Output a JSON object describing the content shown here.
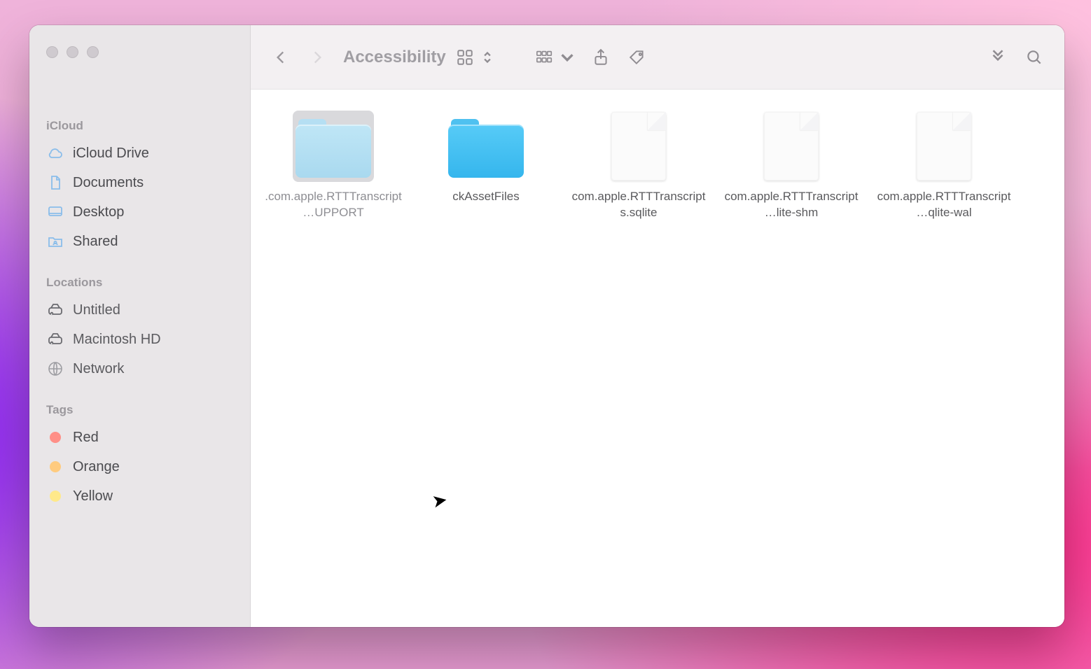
{
  "window": {
    "title": "Accessibility"
  },
  "sidebar": {
    "sections": [
      {
        "header": "iCloud",
        "items": [
          {
            "name": "sidebar-item-icloud-drive",
            "label": "iCloud Drive",
            "icon": "cloud",
            "interactable": true
          },
          {
            "name": "sidebar-item-documents",
            "label": "Documents",
            "icon": "doc",
            "interactable": true
          },
          {
            "name": "sidebar-item-desktop",
            "label": "Desktop",
            "icon": "desktop",
            "interactable": true
          },
          {
            "name": "sidebar-item-shared",
            "label": "Shared",
            "icon": "shared",
            "interactable": true
          }
        ]
      },
      {
        "header": "Locations",
        "items": [
          {
            "name": "sidebar-item-untitled",
            "label": "Untitled",
            "icon": "disk",
            "interactable": true
          },
          {
            "name": "sidebar-item-macintosh-hd",
            "label": "Macintosh HD",
            "icon": "disk",
            "interactable": true
          },
          {
            "name": "sidebar-item-network",
            "label": "Network",
            "icon": "globe",
            "interactable": true
          }
        ]
      },
      {
        "header": "Tags",
        "items": [
          {
            "name": "sidebar-tag-red",
            "label": "Red",
            "icon": "tagdot",
            "color": "#ff8f87",
            "interactable": true
          },
          {
            "name": "sidebar-tag-orange",
            "label": "Orange",
            "icon": "tagdot",
            "color": "#ffcb7f",
            "interactable": true
          },
          {
            "name": "sidebar-tag-yellow",
            "label": "Yellow",
            "icon": "tagdot",
            "color": "#ffe98a",
            "interactable": true
          }
        ]
      }
    ]
  },
  "items": [
    {
      "name": "item-rtt-support",
      "type": "folder-light",
      "label": ".com.apple.RTTTranscript…UPPORT",
      "selected": true
    },
    {
      "name": "item-ckassetfiles",
      "type": "folder-blue",
      "label": "ckAssetFiles"
    },
    {
      "name": "item-sqlite",
      "type": "doc",
      "label": "com.apple.RTTTranscripts.sqlite"
    },
    {
      "name": "item-sqlite-shm",
      "type": "doc",
      "label": "com.apple.RTTTranscript…lite-shm"
    },
    {
      "name": "item-sqlite-wal",
      "type": "doc",
      "label": "com.apple.RTTTranscript…qlite-wal"
    }
  ],
  "toolbar": {
    "view_mode": "icons",
    "tags_label": ""
  }
}
